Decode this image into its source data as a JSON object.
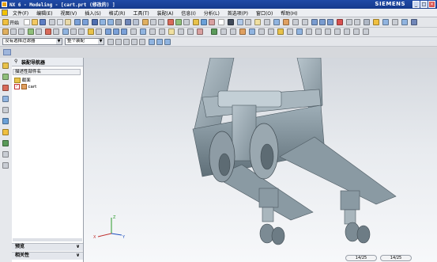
{
  "titlebar": {
    "title": "NX 6 - Modeling - [cart.prt (修改的) ]",
    "brand": "SIEMENS",
    "minimize": "_",
    "maximize": "□",
    "close": "×"
  },
  "menu": [
    "文件(F)",
    "编辑(E)",
    "视图(V)",
    "插入(S)",
    "格式(R)",
    "工具(T)",
    "装配(A)",
    "信息(I)",
    "分析(L)",
    "首选项(P)",
    "窗口(O)",
    "帮助(H)"
  ],
  "toolbar": {
    "start_label": "开始",
    "filter_select": "没有选择过滤器",
    "assembly_select": "整个装配"
  },
  "navigator": {
    "title": "装配导航器",
    "column_header": "描述性部件名",
    "items": [
      {
        "label": "截面",
        "checked": false
      },
      {
        "label": "cart",
        "checked": true
      }
    ],
    "panels": [
      "预览",
      "相关性"
    ]
  },
  "status": {
    "left_count": "14/25",
    "right_count": "14/25"
  },
  "triad": {
    "x": "X",
    "y": "Y",
    "z": "Z"
  }
}
